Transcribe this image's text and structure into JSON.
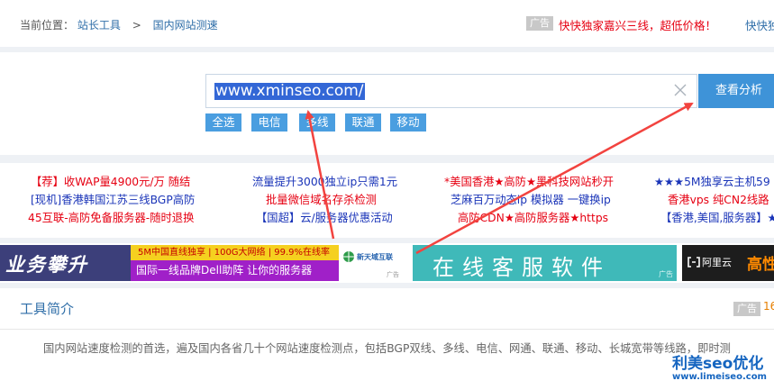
{
  "breadcrumb": {
    "prefix": "当前位置：",
    "items": [
      "站长工具",
      "国内网站测速"
    ],
    "separator": ">"
  },
  "top_ad": {
    "tag": "广告",
    "text_red": "快快独家嘉兴三线，超低价格！",
    "text_blue": "快快独"
  },
  "search": {
    "url_value": "www.xminseo.com/",
    "submit_label": "查看分析",
    "chips": [
      "全选",
      "电信",
      "多线",
      "联通",
      "移动"
    ]
  },
  "ad_links": [
    {
      "text": "【荐】收WAP量4900元/万 随结",
      "color": "red"
    },
    {
      "text": "流量提升3000独立ip只需1元",
      "color": "blue"
    },
    {
      "text": "*美国香港★高防★黑科技网站秒开",
      "color": "red"
    },
    {
      "text": "★★★5M独享云主机59",
      "color": "blue"
    },
    {
      "text": "[现机]香港韩国江苏三线BGP高防",
      "color": "blue"
    },
    {
      "text": "批量微信域名存杀检测",
      "color": "red"
    },
    {
      "text": "芝麻百万动态ip 模拟器 一键换ip",
      "color": "blue"
    },
    {
      "text": "香港vps 纯CN2线路 ↓",
      "color": "red"
    },
    {
      "text": "45互联-高防免备服务器-随时退换",
      "color": "red"
    },
    {
      "text": "【国超】云/服务器优惠活动",
      "color": "blue"
    },
    {
      "text": "高防CDN★高防服务器★https",
      "color": "red"
    },
    {
      "text": "【香港,美国,服务器】★",
      "color": "blue"
    }
  ],
  "banners": {
    "b1_big": "业务攀升",
    "b1_top": "5M中国直线独享 | 100G大网络 | 99.9%在线率",
    "b1_bottom": "国际一线品牌Dell助阵 让你的服务器",
    "b1_logo": "新天域互联",
    "b1_ad": "广告",
    "b2_text": "在线客服软件",
    "b2_ad": "广告",
    "b3_text": "阿里云",
    "b3_text2": "高性"
  },
  "intro": {
    "title": "工具简介",
    "ad_tag": "广告",
    "ad_num": "16",
    "desc": "国内网站速度检测的首选，遍及国内各省几十个网站速度检测点，包括BGP双线、多线、电信、网通、联通、移动、长城宽带等线路，即时测"
  },
  "watermark": {
    "title": "利美seo优化",
    "url": "www.limeiseo.com"
  },
  "colors": {
    "accent": "#3e93d8",
    "red": "#e60012",
    "link_blue": "#2f6ea8",
    "annotation_arrow": "#f2433f"
  }
}
